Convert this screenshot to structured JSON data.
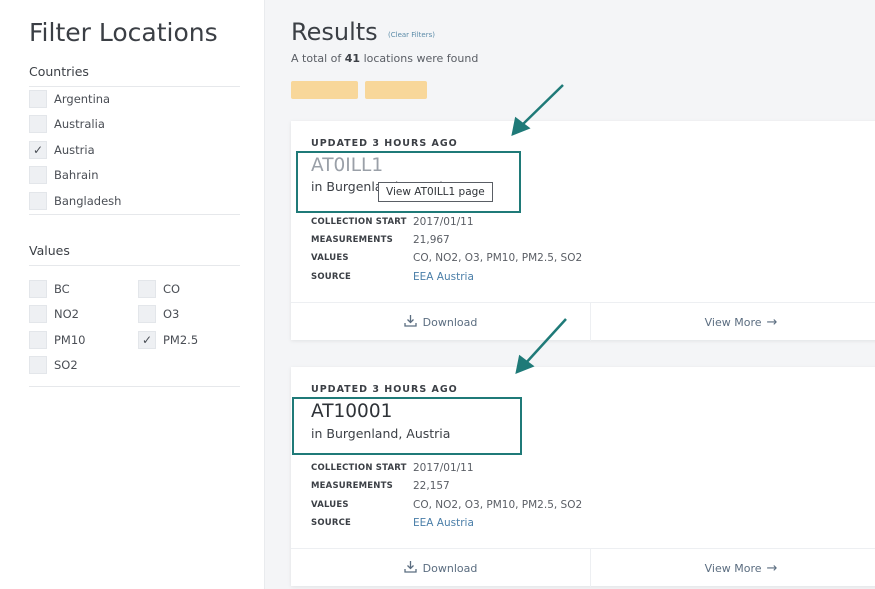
{
  "sidebar": {
    "title": "Filter Locations",
    "countries": {
      "heading": "Countries",
      "items": [
        {
          "label": "Argentina",
          "checked": false
        },
        {
          "label": "Australia",
          "checked": false
        },
        {
          "label": "Austria",
          "checked": true
        },
        {
          "label": "Bahrain",
          "checked": false
        },
        {
          "label": "Bangladesh",
          "checked": false
        }
      ]
    },
    "values": {
      "heading": "Values",
      "items": [
        {
          "label": "BC",
          "checked": false
        },
        {
          "label": "CO",
          "checked": false
        },
        {
          "label": "NO2",
          "checked": false
        },
        {
          "label": "O3",
          "checked": false
        },
        {
          "label": "PM10",
          "checked": false
        },
        {
          "label": "PM2.5",
          "checked": true
        },
        {
          "label": "SO2",
          "checked": false
        }
      ]
    }
  },
  "main": {
    "title": "Results",
    "clear_filters": "(Clear Filters)",
    "summary_prefix": "A total of ",
    "summary_count": "41",
    "summary_suffix": " locations were found",
    "chip_color": "#f8d79a",
    "cards": [
      {
        "updated": "UPDATED 3 HOURS AGO",
        "name": "AT0ILL1",
        "place": "in Burgenland, Austria",
        "tooltip": "View AT0ILL1 page",
        "collection_start_label": "COLLECTION START",
        "collection_start": "2017/01/11",
        "measurements_label": "MEASUREMENTS",
        "measurements": "21,967",
        "values_label": "VALUES",
        "values": "CO, NO2, O3, PM10, PM2.5, SO2",
        "source_label": "SOURCE",
        "source": "EEA Austria",
        "download_label": "Download",
        "view_more_label": "View More"
      },
      {
        "updated": "UPDATED 3 HOURS AGO",
        "name": "AT10001",
        "place": "in Burgenland, Austria",
        "collection_start_label": "COLLECTION START",
        "collection_start": "2017/01/11",
        "measurements_label": "MEASUREMENTS",
        "measurements": "22,157",
        "values_label": "VALUES",
        "values": "CO, NO2, O3, PM10, PM2.5, SO2",
        "source_label": "SOURCE",
        "source": "EEA Austria",
        "download_label": "Download",
        "view_more_label": "View More"
      }
    ]
  },
  "annotation_color": "#1f7a78",
  "icons": {
    "check": "check-icon",
    "download": "download-icon",
    "arrow": "arrow-right-icon"
  }
}
